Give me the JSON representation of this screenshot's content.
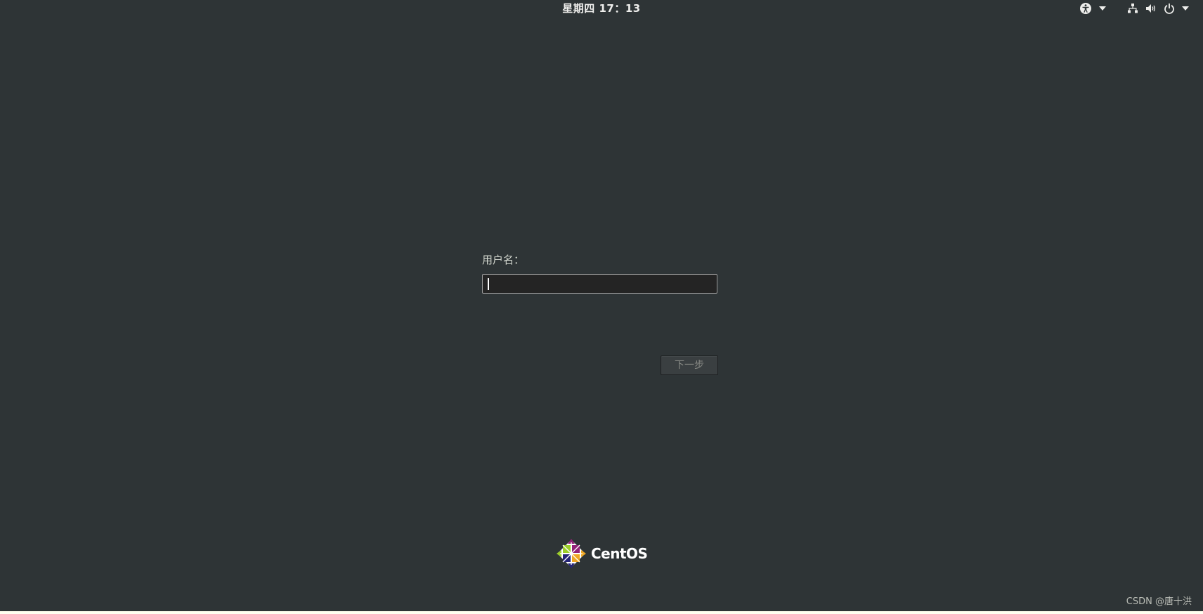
{
  "topbar": {
    "clock": "星期四  17：13",
    "icons": {
      "accessibility": "accessibility-icon",
      "accessibility_menu": "chevron-down-icon",
      "network": "network-wired-icon",
      "volume": "volume-icon",
      "power": "power-icon",
      "system_menu": "chevron-down-icon"
    }
  },
  "login": {
    "username_label": "用户名：",
    "username_value": "",
    "next_button": "下一步"
  },
  "logo": {
    "text": "CentOS"
  },
  "watermark": "CSDN @唐十洪",
  "colors": {
    "background": "#2e3436",
    "text": "#eeeeec",
    "input_bg": "#242424",
    "button_disabled_text": "#888a85"
  }
}
